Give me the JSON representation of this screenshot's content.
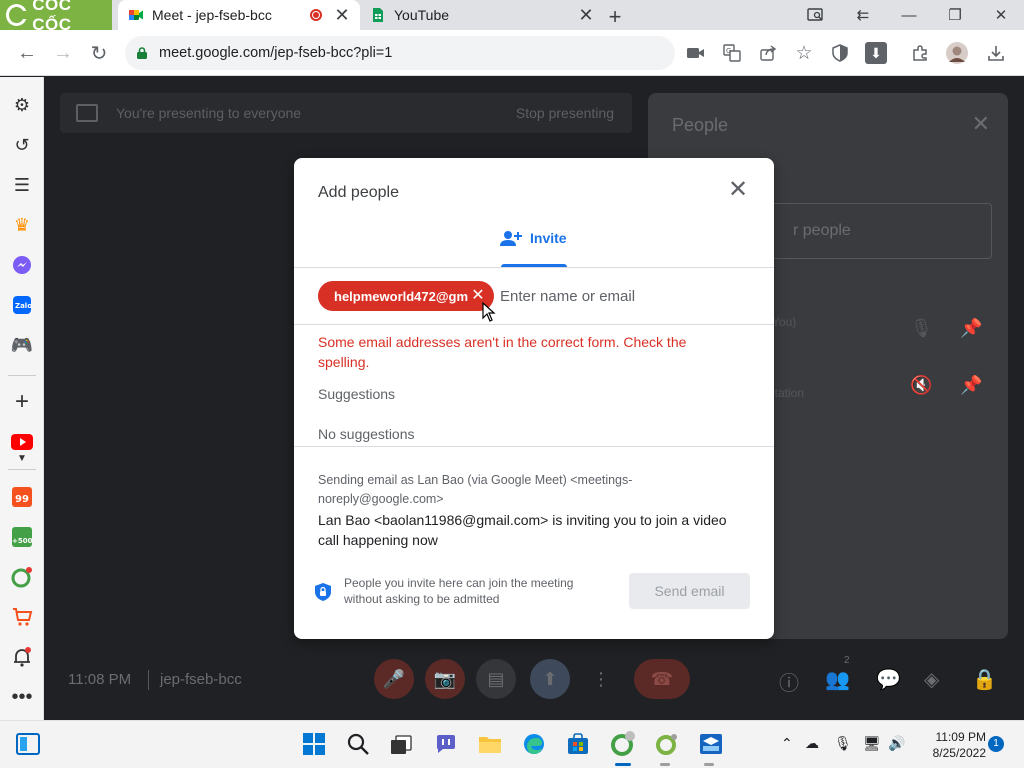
{
  "browser": {
    "brand": "CỐC CỐC",
    "tabs": [
      {
        "title": "Meet - jep-fseb-bcc",
        "active": true
      },
      {
        "title": "YouTube",
        "active": false
      }
    ],
    "url": "meet.google.com/jep-fseb-bcc?pli=1"
  },
  "meet": {
    "banner_text": "You're presenting to everyone",
    "banner_action": "Stop presenting",
    "people_title": "People",
    "people_search_partial": "r people",
    "people_row1": "(You)",
    "people_row2": "ntation",
    "time": "11:08 PM",
    "meeting_code": "jep-fseb-bcc",
    "participants_badge": "2"
  },
  "dialog": {
    "title": "Add people",
    "tab_invite": "Invite",
    "chip_email": "helpmeworld472@gm",
    "input_placeholder": "Enter name or email",
    "error": "Some email addresses aren't in the correct form. Check the spelling.",
    "suggestions_title": "Suggestions",
    "no_suggestions": "No suggestions",
    "sender": "Sending email as Lan Bao (via Google Meet) <meetings-noreply@google.com>",
    "message": "Lan Bao <baolan11986@gmail.com> is inviting you to join a video call happening now",
    "note": "People you invite here can join the meeting without asking to be admitted",
    "send_label": "Send email"
  },
  "taskbar": {
    "time": "11:09 PM",
    "date": "8/25/2022",
    "notifications": "1"
  },
  "colors": {
    "accent": "#1a73e8",
    "error": "#d93025",
    "brand_green": "#7cb342"
  }
}
